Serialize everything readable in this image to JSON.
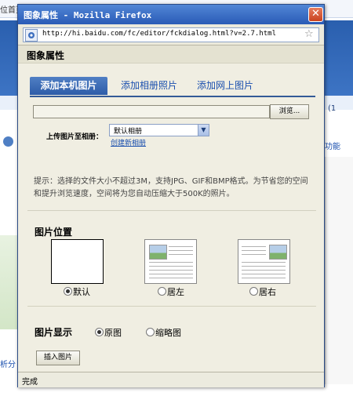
{
  "background": {
    "top_left_text": "位首页",
    "right_number": "(1",
    "right_link": "功能",
    "left_bottom_text": "析分"
  },
  "window": {
    "title": "图象属性 - Mozilla Firefox",
    "close_glyph": "✕",
    "url": "http://hi.baidu.com/fc/editor/fckdialog.html?v=2.7.html",
    "star_glyph": "☆"
  },
  "dialog": {
    "heading": "图象属性",
    "tabs": [
      "添加本机图片",
      "添加相册照片",
      "添加网上图片"
    ],
    "active_tab": 0,
    "file_input_value": "",
    "browse_label": "浏览...",
    "upload_label": "上传图片至相册：",
    "album_selected": "默认相册",
    "create_album_link": "创建新相册",
    "hint": "提示：选择的文件大小不超过3M，支持JPG、GIF和BMP格式。为节省您的空间和提升浏览速度，空间将为您自动压缩大于500K的照片。",
    "position_title": "图片位置",
    "position_options": [
      "默认",
      "居左",
      "居右"
    ],
    "position_selected": "默认",
    "display_title": "图片显示",
    "display_options": [
      "原图",
      "缩略图"
    ],
    "display_selected": "原图",
    "insert_label": "插入图片"
  },
  "status": {
    "text": "完成"
  },
  "colors": {
    "titlebar": "#2a5bb6",
    "active_tab": "#2d5ca8",
    "window_bg": "#f0eee2",
    "link": "#1a4fae"
  }
}
